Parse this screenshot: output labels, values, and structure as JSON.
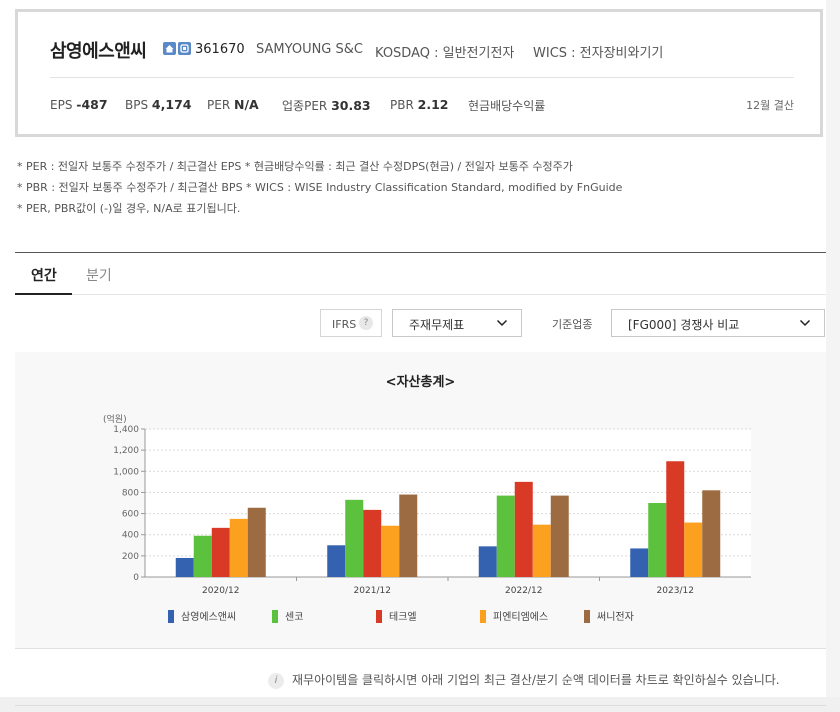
{
  "company": {
    "name": "삼영에스앤씨",
    "code": "361670",
    "english_name": "SAMYOUNG S&C",
    "market": "KOSDAQ : 일반전기전자",
    "wics": "WICS : 전자장비와기기",
    "icons": [
      "home-icon",
      "phone-icon"
    ]
  },
  "metrics": [
    {
      "label": "EPS",
      "value": "-487"
    },
    {
      "label": "BPS",
      "value": "4,174"
    },
    {
      "label": "PER",
      "value": "N/A"
    },
    {
      "label": "업종PER",
      "value": "30.83"
    },
    {
      "label": "PBR",
      "value": "2.12"
    },
    {
      "label": "현금배당수익률",
      "value": ""
    }
  ],
  "fiscal_note": "12월 결산",
  "notes": [
    "* PER : 전일자 보통주 수정주가 / 최근결산 EPS * 현금배당수익률 : 최근 결산 수정DPS(현금) / 전일자 보통주 수정주가",
    "* PBR : 전일자 보통주 수정주가 / 최근결산 BPS * WICS : WISE Industry Classification Standard, modified by FnGuide",
    "* PER, PBR값이 (-)일 경우, N/A로 표기됩니다."
  ],
  "tabs": [
    {
      "label": "연간",
      "active": true
    },
    {
      "label": "분기",
      "active": false
    }
  ],
  "controls": {
    "ifrs_label": "IFRS",
    "help_symbol": "?",
    "report_select": "주재무제표",
    "industry_label": "기준업종",
    "industry_select": "[FG000] 경쟁사 비교"
  },
  "chart_data": {
    "type": "bar",
    "title": "<자산총계>",
    "unit_label": "(억원)",
    "ylim": [
      0,
      1400
    ],
    "yticks": [
      "0",
      "200",
      "400",
      "600",
      "800",
      "1,000",
      "1,200",
      "1,400"
    ],
    "ytick_values": [
      0,
      200,
      400,
      600,
      800,
      1000,
      1200,
      1400
    ],
    "grid": true,
    "legend_position": "bottom",
    "categories": [
      "2020/12",
      "2021/12",
      "2022/12",
      "2023/12"
    ],
    "series": [
      {
        "name": "삼영에스앤씨",
        "color": "#3461b0",
        "values": [
          180,
          300,
          290,
          270
        ]
      },
      {
        "name": "센코",
        "color": "#5cc13c",
        "values": [
          390,
          730,
          770,
          700
        ]
      },
      {
        "name": "테크엘",
        "color": "#d93a26",
        "values": [
          465,
          635,
          900,
          1095
        ]
      },
      {
        "name": "피엔티엠에스",
        "color": "#fca020",
        "values": [
          550,
          485,
          495,
          515
        ]
      },
      {
        "name": "써니전자",
        "color": "#9c6b42",
        "values": [
          655,
          780,
          770,
          820
        ]
      }
    ]
  },
  "info_text": "재무아이템을 클릭하시면 아래 기업의 최근 결산/분기 순액 데이터를 차트로 확인하실수 있습니다.",
  "info_symbol": "i"
}
